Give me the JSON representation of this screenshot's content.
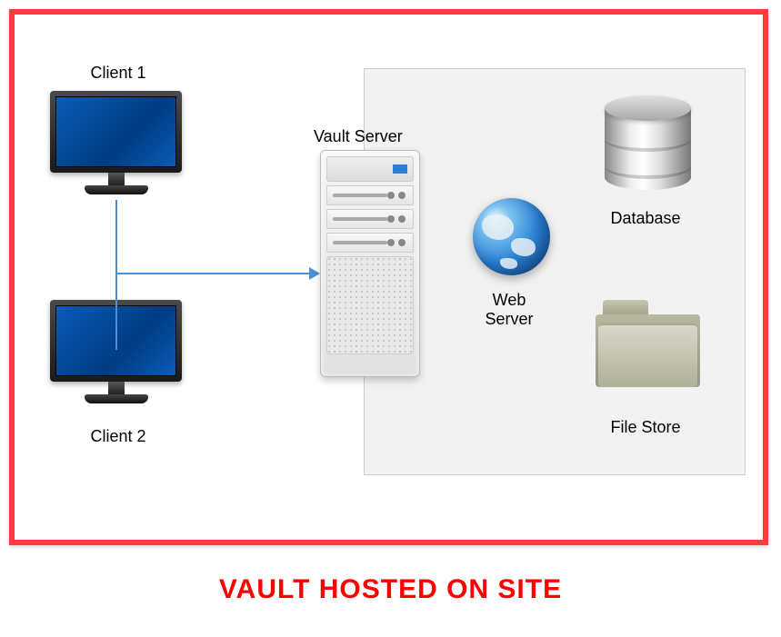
{
  "caption": "VAULT HOSTED ON SITE",
  "labels": {
    "client1": "Client 1",
    "client2": "Client 2",
    "vault_server": "Vault Server",
    "web_server": "Web\nServer",
    "database": "Database",
    "file_store": "File Store"
  },
  "colors": {
    "border": "#ff3b3b",
    "caption": "#ff0000",
    "connector": "#4a90d9",
    "panel_bg": "#f2f2f2"
  },
  "diagram": {
    "clients": [
      "Client 1",
      "Client 2"
    ],
    "server_components": [
      "Web Server",
      "Database",
      "File Store"
    ],
    "server_name": "Vault Server",
    "connection": "Clients → Vault Server"
  }
}
